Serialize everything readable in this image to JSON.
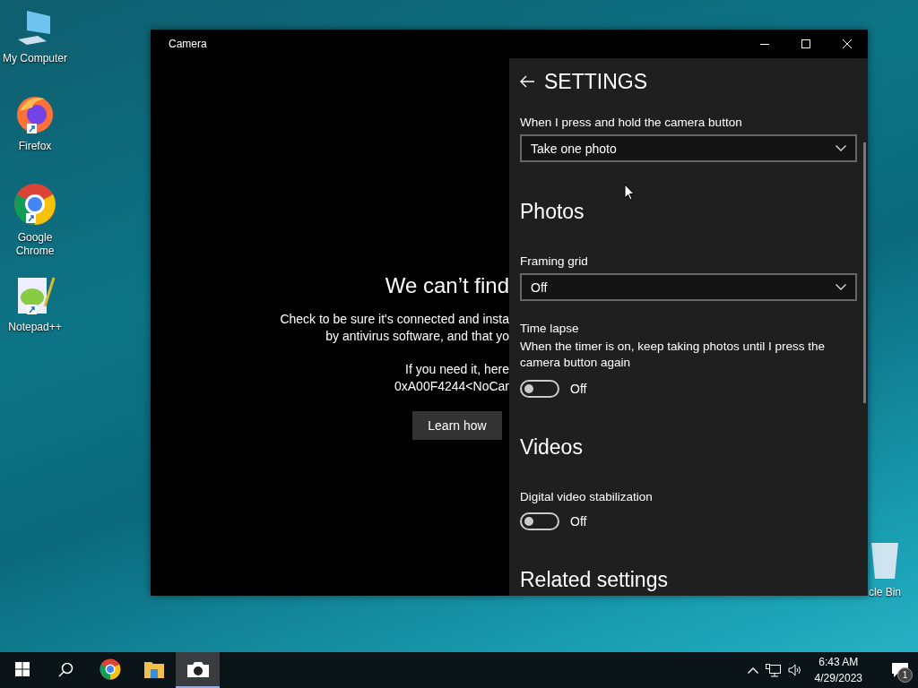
{
  "desktop": {
    "icons": [
      {
        "kind": "computer",
        "label": "My Computer",
        "shortcut": false
      },
      {
        "kind": "firefox",
        "label": "Firefox",
        "shortcut": true
      },
      {
        "kind": "chrome",
        "label": "Google Chrome",
        "shortcut": true
      },
      {
        "kind": "notepad",
        "label": "Notepad++",
        "shortcut": true
      },
      {
        "kind": "recycle",
        "label": "cle Bin",
        "shortcut": false
      }
    ]
  },
  "window": {
    "title": "Camera",
    "error": {
      "title": "We can’t find",
      "lines": [
        "Check to be sure it's connected and insta",
        "by antivirus software, and that yo"
      ],
      "code_lines": [
        "If you need it, here",
        "0xA00F4244<NoCar"
      ],
      "button": "Learn how"
    },
    "settings": {
      "title": "SETTINGS",
      "items": [
        {
          "kind": "dropdown",
          "label": "When I press and hold the camera button",
          "value": "Take one photo"
        },
        {
          "kind": "heading",
          "text": "Photos"
        },
        {
          "kind": "dropdown",
          "label": "Framing grid",
          "value": "Off"
        },
        {
          "kind": "toggle",
          "label": "Time lapse",
          "description": "When the timer is on, keep taking photos until I press the camera button again",
          "on": false,
          "state_text": "Off"
        },
        {
          "kind": "heading",
          "text": "Videos"
        },
        {
          "kind": "toggle",
          "label": "Digital video stabilization",
          "on": false,
          "state_text": "Off"
        },
        {
          "kind": "heading",
          "text": "Related settings"
        }
      ]
    }
  },
  "taskbar": {
    "apps": [
      {
        "kind": "start",
        "selected": false
      },
      {
        "kind": "search",
        "selected": false
      },
      {
        "kind": "chrome",
        "selected": false
      },
      {
        "kind": "folder",
        "selected": false
      },
      {
        "kind": "camera",
        "selected": true
      }
    ],
    "time": "6:43 AM",
    "date": "4/29/2023",
    "notifications": "1"
  }
}
